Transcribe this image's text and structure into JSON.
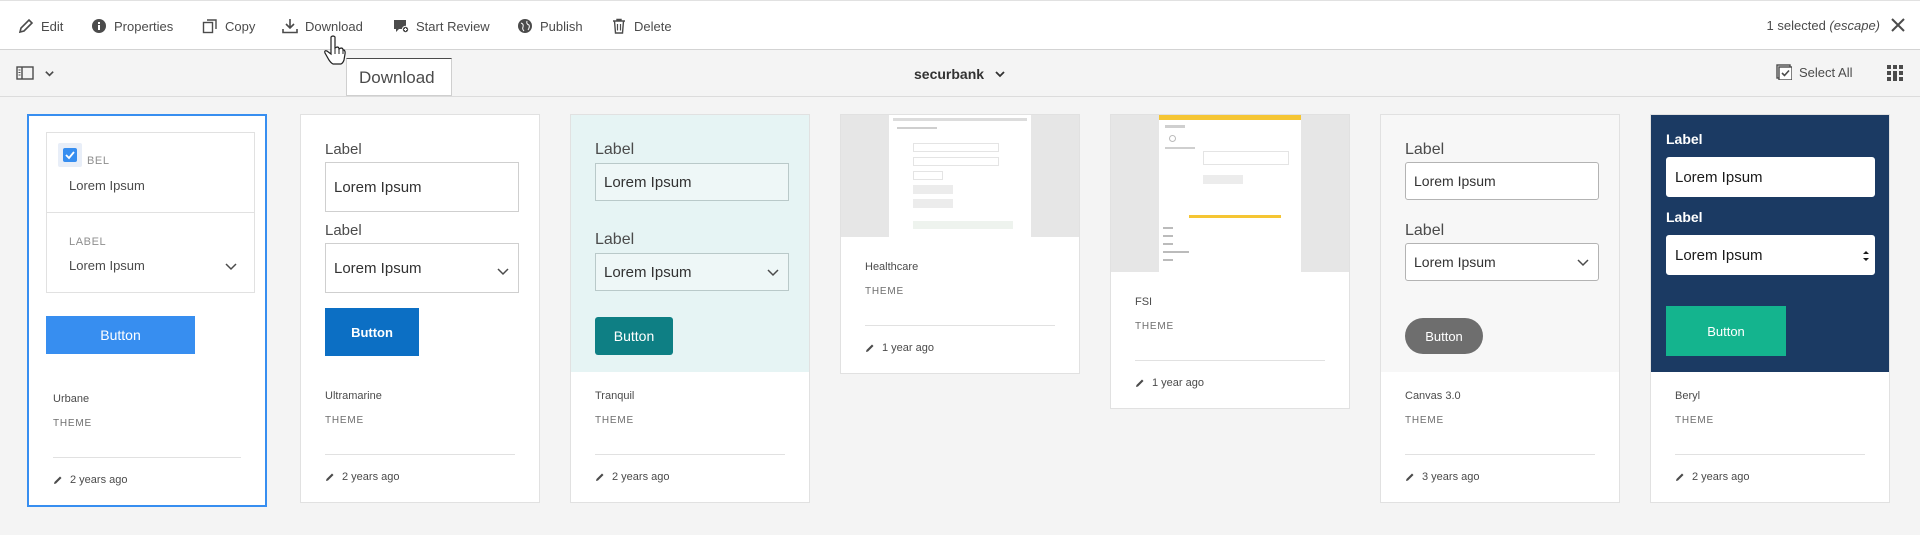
{
  "actionbar": {
    "edit": "Edit",
    "properties": "Properties",
    "copy": "Copy",
    "download": "Download",
    "start_review": "Start Review",
    "publish": "Publish",
    "delete": "Delete",
    "selected_count": "1 selected",
    "escape_hint": "(escape)"
  },
  "tooltip": "Download",
  "toolbar": {
    "breadcrumb": "securbank",
    "select_all": "Select All"
  },
  "cards": [
    {
      "name": "Urbane",
      "type": "THEME",
      "modified": "2 years ago",
      "thumb": {
        "label1": "BEL",
        "value1": "Lorem Ipsum",
        "label2": "LABEL",
        "value2": "Lorem Ipsum",
        "button": "Button"
      }
    },
    {
      "name": "Ultramarine",
      "type": "THEME",
      "modified": "2 years ago",
      "thumb": {
        "label1": "Label",
        "value1": "Lorem Ipsum",
        "label2": "Label",
        "value2": "Lorem Ipsum",
        "button": "Button"
      }
    },
    {
      "name": "Tranquil",
      "type": "THEME",
      "modified": "2 years ago",
      "thumb": {
        "label1": "Label",
        "value1": "Lorem Ipsum",
        "label2": "Label",
        "value2": "Lorem Ipsum",
        "button": "Button"
      }
    },
    {
      "name": "Healthcare",
      "type": "THEME",
      "modified": "1 year ago"
    },
    {
      "name": "FSI",
      "type": "THEME",
      "modified": "1 year ago"
    },
    {
      "name": "Canvas 3.0",
      "type": "THEME",
      "modified": "3 years ago",
      "thumb": {
        "label1": "Label",
        "value1": "Lorem Ipsum",
        "label2": "Label",
        "value2": "Lorem Ipsum",
        "button": "Button"
      }
    },
    {
      "name": "Beryl",
      "type": "THEME",
      "modified": "2 years ago",
      "thumb": {
        "label1": "Label",
        "value1": "Lorem Ipsum",
        "label2": "Label",
        "value2": "Lorem Ipsum",
        "button": "Button"
      }
    }
  ],
  "colors": {
    "accent": "#378ef0",
    "urbane_button": "#378ef0",
    "ultramarine_button": "#0c6fc4",
    "tranquil_bg": "#e6f4f4",
    "tranquil_button": "#0e7f84",
    "canvas_button": "#6e6e6e",
    "beryl_bg": "#1b3a63",
    "beryl_button": "#14b48e"
  }
}
